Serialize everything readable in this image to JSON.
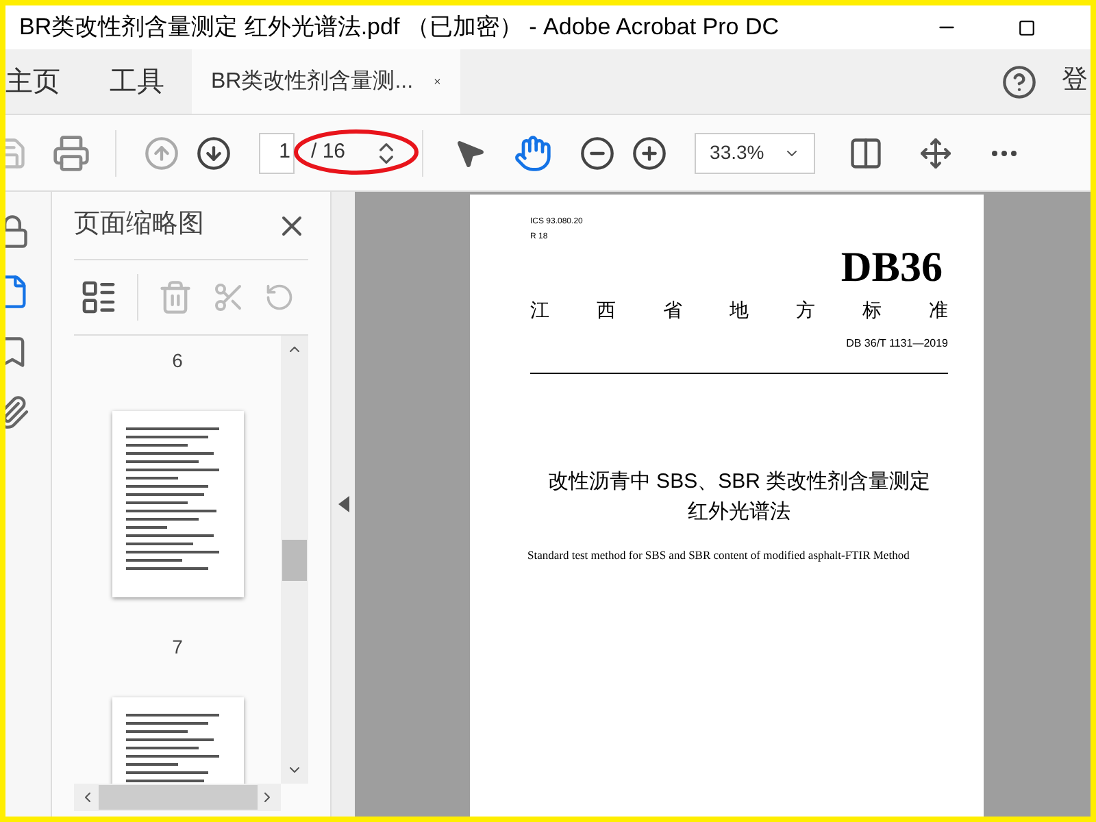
{
  "window": {
    "title": "BR类改性剂含量测定 红外光谱法.pdf （已加密） - Adobe Acrobat Pro DC"
  },
  "nav_tabs": [
    {
      "label": "主页",
      "kind": "app",
      "selected": false
    },
    {
      "label": "工具",
      "kind": "app",
      "selected": false
    },
    {
      "label": "BR类改性剂含量测...",
      "kind": "document",
      "selected": true
    }
  ],
  "account": "登",
  "toolbar": {
    "page_current": "1",
    "page_total": "/ 16",
    "zoom": "33.3%"
  },
  "sidebar_tools": [
    {
      "kind": "lock",
      "selected": false
    },
    {
      "kind": "pages",
      "selected": true
    },
    {
      "kind": "bookmark",
      "selected": false
    },
    {
      "kind": "attachment",
      "selected": false
    }
  ],
  "panel": {
    "title": "页面缩略图",
    "thumbnail_labels": [
      "6",
      "7"
    ]
  },
  "document": {
    "ics": "ICS 93.080.20",
    "code": "R 18",
    "logo": "DB36",
    "org_chars": [
      "江",
      "西",
      "省",
      "地",
      "方",
      "标",
      "准"
    ],
    "number": "DB 36/T 1131—2019",
    "title_lines": [
      "改性沥青中 SBS、SBR 类改性剂含量测定",
      "红外光谱法"
    ],
    "subtitle": "Standard test method for SBS and SBR content of modified asphalt-FTIR Method"
  }
}
